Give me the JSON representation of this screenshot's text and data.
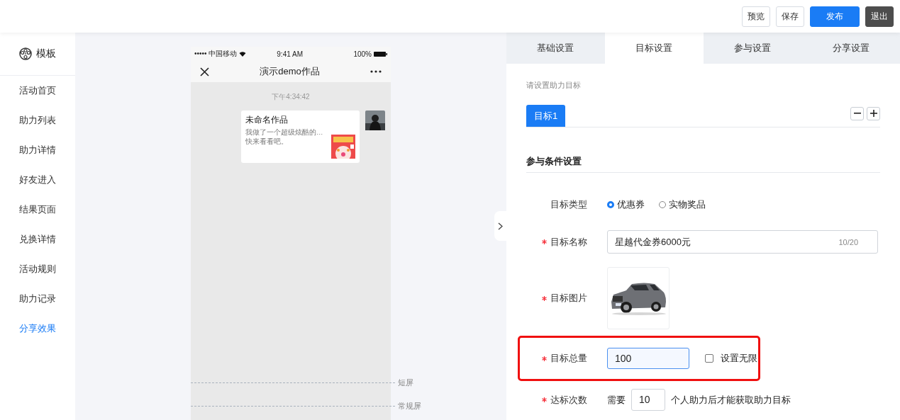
{
  "toolbar": {
    "buttons": [
      {
        "label": "预览",
        "kind": "default"
      },
      {
        "label": "保存",
        "kind": "default"
      },
      {
        "label": "发布",
        "kind": "primary"
      },
      {
        "label": "退出",
        "kind": "dark"
      }
    ]
  },
  "sidebar": {
    "header": "模板",
    "items": [
      {
        "label": "活动首页",
        "selected": false
      },
      {
        "label": "助力列表",
        "selected": false
      },
      {
        "label": "助力详情",
        "selected": false
      },
      {
        "label": "好友进入",
        "selected": false
      },
      {
        "label": "结果页面",
        "selected": false
      },
      {
        "label": "兑换详情",
        "selected": false
      },
      {
        "label": "活动规则",
        "selected": false
      },
      {
        "label": "助力记录",
        "selected": false
      },
      {
        "label": "分享效果",
        "selected": true
      }
    ]
  },
  "phone": {
    "status": {
      "carrier": "••••• 中国移动",
      "time": "9:41 AM",
      "battery": "100%"
    },
    "title": "演示demo作品",
    "timestamp": "下午4:34:42",
    "message": {
      "title": "未命名作品",
      "lines": [
        "我做了一个超级炫酷的…",
        "快来看看吧。"
      ]
    },
    "markers": [
      {
        "label": "短屏"
      },
      {
        "label": "常规屏"
      }
    ]
  },
  "tabs": [
    {
      "label": "基础设置",
      "selected": false
    },
    {
      "label": "目标设置",
      "selected": true
    },
    {
      "label": "参与设置",
      "selected": false
    },
    {
      "label": "分享设置",
      "selected": false
    }
  ],
  "hint": "请设置助力目标",
  "goal_tabs": [
    {
      "label": "目标1",
      "selected": true
    }
  ],
  "section_title": "参与条件设置",
  "form": [
    {
      "kind": "radio",
      "label": "目标类型",
      "required": false,
      "options": [
        {
          "label": "优惠券",
          "selected": true
        },
        {
          "label": "实物奖品",
          "selected": false
        }
      ]
    },
    {
      "kind": "text",
      "label": "目标名称",
      "required": true,
      "value": "星越代金券6000元",
      "counter": "10/20"
    },
    {
      "label": "目标图片",
      "required": true
    },
    {
      "kind": "number",
      "label": "目标总量",
      "required": true,
      "value": "100",
      "focused": true,
      "highlighted": true,
      "checkbox": {
        "label": "设置无限",
        "checked": false
      }
    },
    {
      "kind": "inline",
      "label": "达标次数",
      "required": true,
      "prefix": "需要",
      "value": "10",
      "suffix": "个人助力后才能获取助力目标"
    }
  ]
}
